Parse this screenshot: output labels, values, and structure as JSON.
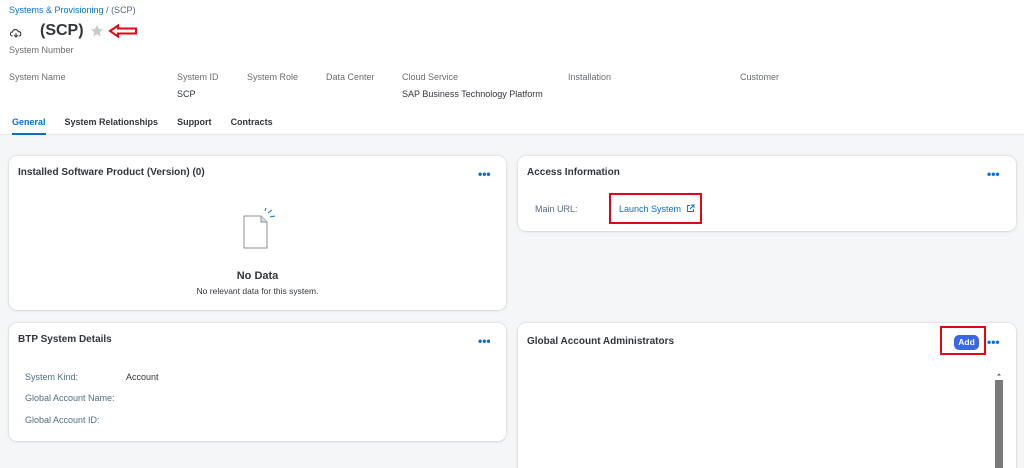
{
  "breadcrumb": {
    "parent": "Systems & Provisioning",
    "separator": " / ",
    "current": "(SCP)"
  },
  "header": {
    "title": "(SCP)",
    "subtitle": "System Number"
  },
  "attributes": [
    {
      "label": "System Name",
      "value": ""
    },
    {
      "label": "System ID",
      "value": "SCP"
    },
    {
      "label": "System Role",
      "value": ""
    },
    {
      "label": "Data Center",
      "value": ""
    },
    {
      "label": "Cloud Service",
      "value": "SAP Business Technology Platform"
    },
    {
      "label": "Installation",
      "value": ""
    },
    {
      "label": "Customer",
      "value": ""
    }
  ],
  "tabs": [
    {
      "label": "General",
      "active": true
    },
    {
      "label": "System Relationships"
    },
    {
      "label": "Support"
    },
    {
      "label": "Contracts"
    }
  ],
  "installed": {
    "title": "Installed Software Product (Version) (0)",
    "more": "•••",
    "nodata_title": "No Data",
    "nodata_sub": "No relevant data for this system."
  },
  "access": {
    "title": "Access Information",
    "more": "•••",
    "main_url_label": "Main URL:",
    "launch_label": "Launch System"
  },
  "btp": {
    "title": "BTP System Details",
    "more": "•••",
    "system_kind_label": "System Kind:",
    "system_kind_value": "Account",
    "global_account_name_label": "Global Account Name:",
    "global_account_id_label": "Global Account ID:"
  },
  "admins": {
    "title": "Global Account Administrators",
    "add_label": "Add",
    "more": "•••"
  },
  "colors": {
    "accent": "#0a6ed1",
    "annotation": "#e30613",
    "button": "#3868e6"
  },
  "icons": [
    "cloud-system-icon",
    "star-icon",
    "external-link-icon",
    "document-icon",
    "chevron-up-icon"
  ]
}
